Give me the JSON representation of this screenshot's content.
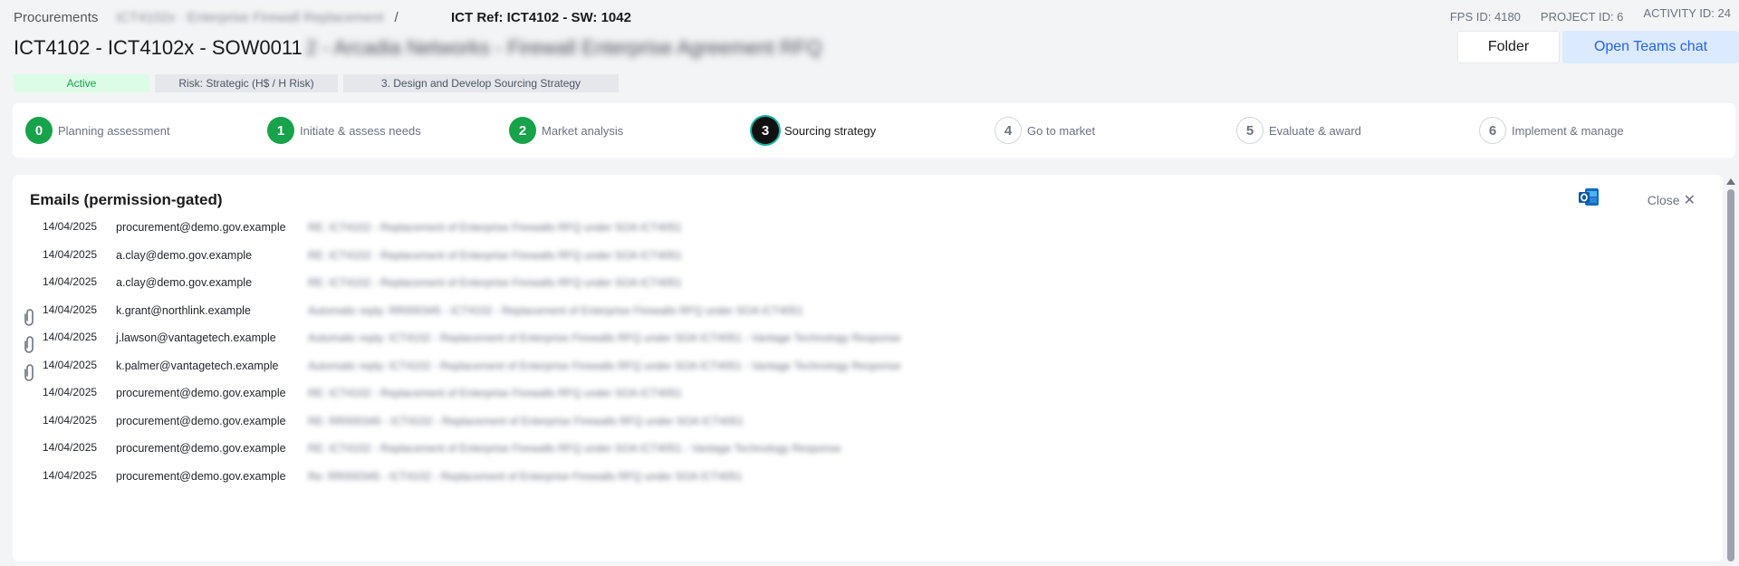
{
  "breadcrumb": {
    "root": "Procurements",
    "blurred": "ICT4102x · Enterprise Firewall Replacement",
    "separator": "/",
    "current": "ICT Ref: ICT4102 - SW: 1042"
  },
  "meta": {
    "fps_id": "FPS ID: 4180",
    "project_id": "PROJECT ID: 6",
    "activity_id": "ACTIVITY ID: 24"
  },
  "title": {
    "visible": "ICT4102 - ICT4102x - SOW0011",
    "blurred": "2 - Arcadia Networks - Firewall Enterprise Agreement RFQ"
  },
  "actions": {
    "folder": "Folder",
    "teams": "Open Teams chat"
  },
  "badges": {
    "status": "Active",
    "risk": "Risk: Strategic (H$ / H Risk)",
    "phase": "3. Design and Develop Sourcing Strategy"
  },
  "steps": [
    {
      "num": "0",
      "label": "Planning assessment",
      "state": "done"
    },
    {
      "num": "1",
      "label": "Initiate & assess needs",
      "state": "done"
    },
    {
      "num": "2",
      "label": "Market analysis",
      "state": "done"
    },
    {
      "num": "3",
      "label": "Sourcing strategy",
      "state": "current"
    },
    {
      "num": "4",
      "label": "Go to market",
      "state": "todo"
    },
    {
      "num": "5",
      "label": "Evaluate & award",
      "state": "todo"
    },
    {
      "num": "6",
      "label": "Implement & manage",
      "state": "todo"
    }
  ],
  "emails_panel": {
    "title": "Emails (permission-gated)",
    "close": "Close",
    "outlook_icon": "outlook-icon",
    "rows": [
      {
        "date": "14/04/2025",
        "from": "procurement@demo.gov.example",
        "subject": "RE: ICT4102 - Replacement of Enterprise Firewalls RFQ under SOA ICT4051",
        "attachment": false
      },
      {
        "date": "14/04/2025",
        "from": "a.clay@demo.gov.example",
        "subject": "RE: ICT4102 - Replacement of Enterprise Firewalls RFQ under SOA ICT4051",
        "attachment": false
      },
      {
        "date": "14/04/2025",
        "from": "a.clay@demo.gov.example",
        "subject": "RE: ICT4102 - Replacement of Enterprise Firewalls RFQ under SOA ICT4051",
        "attachment": false
      },
      {
        "date": "14/04/2025",
        "from": "k.grant@northlink.example",
        "subject": "Automatic reply: RR000345 - ICT4102 - Replacement of Enterprise Firewalls RFQ under SOA ICT4051",
        "attachment": true
      },
      {
        "date": "14/04/2025",
        "from": "j.lawson@vantagetech.example",
        "subject": "Automatic reply: ICT4102 - Replacement of Enterprise Firewalls RFQ under SOA ICT4051 - Vantage Technology Response",
        "attachment": true
      },
      {
        "date": "14/04/2025",
        "from": "k.palmer@vantagetech.example",
        "subject": "Automatic reply: ICT4102 - Replacement of Enterprise Firewalls RFQ under SOA ICT4051 - Vantage Technology Response",
        "attachment": true
      },
      {
        "date": "14/04/2025",
        "from": "procurement@demo.gov.example",
        "subject": "RE: ICT4102 - Replacement of Enterprise Firewalls RFQ under SOA ICT4051",
        "attachment": false
      },
      {
        "date": "14/04/2025",
        "from": "procurement@demo.gov.example",
        "subject": "RE: RR000345 - ICT4102 - Replacement of Enterprise Firewalls RFQ under SOA ICT4051",
        "attachment": false
      },
      {
        "date": "14/04/2025",
        "from": "procurement@demo.gov.example",
        "subject": "RE: ICT4102 - Replacement of Enterprise Firewalls RFQ under SOA ICT4051 - Vantage Technology Response",
        "attachment": false
      },
      {
        "date": "14/04/2025",
        "from": "procurement@demo.gov.example",
        "subject": "Re: RR000345 - ICT4102 - Replacement of Enterprise Firewalls RFQ under SOA ICT4051",
        "attachment": false
      }
    ]
  },
  "colors": {
    "accent_blue": "#2563eb",
    "teams_bg": "#dbeafe",
    "done_green": "#16a34a",
    "active_badge_bg": "#dcfce7",
    "current_step_ring": "#14b8a6"
  }
}
